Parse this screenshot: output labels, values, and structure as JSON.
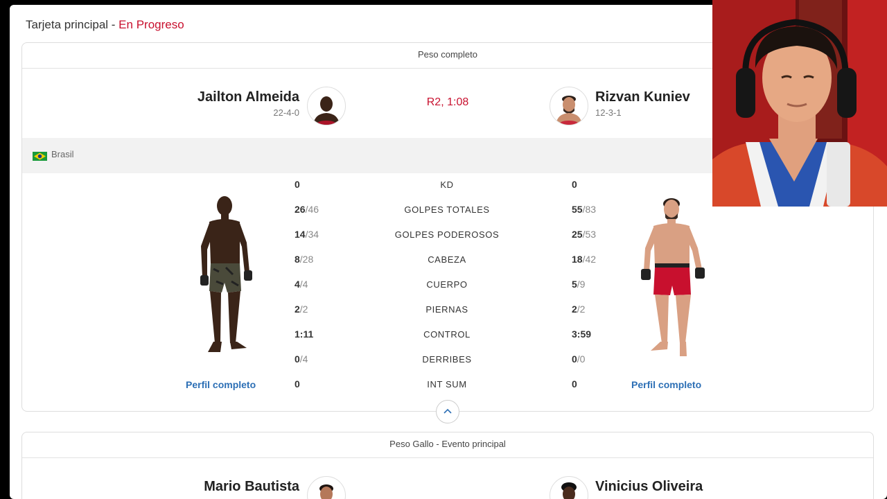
{
  "header": {
    "label": "Tarjeta principal",
    "separator": " - ",
    "status": "En Progreso"
  },
  "bout1": {
    "weight_class": "Peso completo",
    "result": "R2, 1:08",
    "left": {
      "name": "Jailton Almeida",
      "record": "22-4-0",
      "country": "Brasil",
      "profile_link": "Perfil completo"
    },
    "right": {
      "name": "Rizvan Kuniev",
      "record": "12-3-1",
      "profile_link": "Perfil completo"
    },
    "stats": [
      {
        "label": "KD",
        "left": "0",
        "left_total": "",
        "right": "0",
        "right_total": ""
      },
      {
        "label": "GOLPES TOTALES",
        "left": "26",
        "left_total": "/46",
        "right": "55",
        "right_total": "/83"
      },
      {
        "label": "GOLPES PODEROSOS",
        "left": "14",
        "left_total": "/34",
        "right": "25",
        "right_total": "/53"
      },
      {
        "label": "CABEZA",
        "left": "8",
        "left_total": "/28",
        "right": "18",
        "right_total": "/42"
      },
      {
        "label": "CUERPO",
        "left": "4",
        "left_total": "/4",
        "right": "5",
        "right_total": "/9"
      },
      {
        "label": "PIERNAS",
        "left": "2",
        "left_total": "/2",
        "right": "2",
        "right_total": "/2"
      },
      {
        "label": "CONTROL",
        "left": "1:11",
        "left_total": "",
        "right": "3:59",
        "right_total": ""
      },
      {
        "label": "DERRIBES",
        "left": "0",
        "left_total": "/4",
        "right": "0",
        "right_total": "/0"
      },
      {
        "label": "INT SUM",
        "left": "0",
        "left_total": "",
        "right": "0",
        "right_total": ""
      }
    ]
  },
  "bout2": {
    "weight_class": "Peso Gallo - Evento principal",
    "left": {
      "name": "Mario Bautista"
    },
    "right": {
      "name": "Vinicius Oliveira"
    }
  },
  "colors": {
    "accent_red": "#c8102e",
    "link_blue": "#2c6fb5"
  },
  "icons": {
    "collapse": "chevron-up-icon",
    "flag": "brazil-flag-icon"
  }
}
